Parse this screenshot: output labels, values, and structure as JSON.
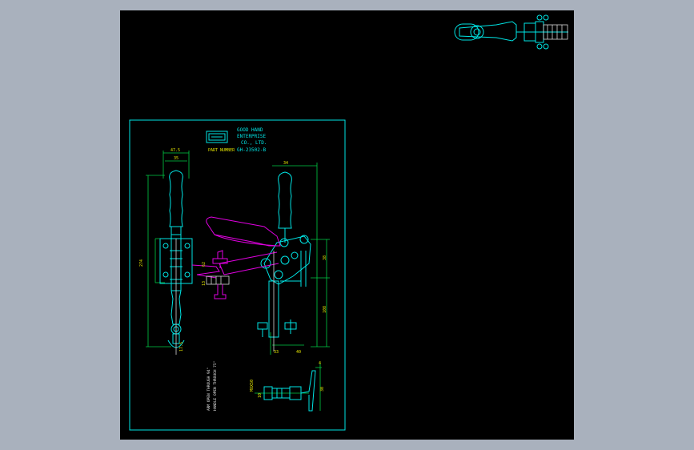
{
  "title_block": {
    "company_line1": "GOOD HAND",
    "company_line2": "ENTERPRISE",
    "company_line3": "CO., LTD.",
    "part_label": "PART NUMBER",
    "part_number": "GH-23502-B"
  },
  "notes": {
    "line1": "ARM OPEN THROUGH 94°",
    "line2": "HANDLE OPEN THROUGH 75°"
  },
  "dimensions": {
    "top_width_a": "47.5",
    "top_width_b": "35",
    "height_total": "274",
    "side_a": "62",
    "side_b": "13",
    "bottom_a": "17.5",
    "right_top": "34",
    "right_upper": "38",
    "right_lower": "108",
    "bottom_left": "33",
    "bottom_right": "40",
    "spindle_a": "M8X50",
    "spindle_b": "10",
    "spindle_c": "30",
    "spindle_d": "4"
  },
  "colors": {
    "background": "#000000",
    "frame": "#a9b1bd",
    "cyan": "#00e5e5",
    "green": "#00cc44",
    "magenta": "#e000e0",
    "white": "#d8d8d8",
    "yellow": "#e6e600"
  }
}
